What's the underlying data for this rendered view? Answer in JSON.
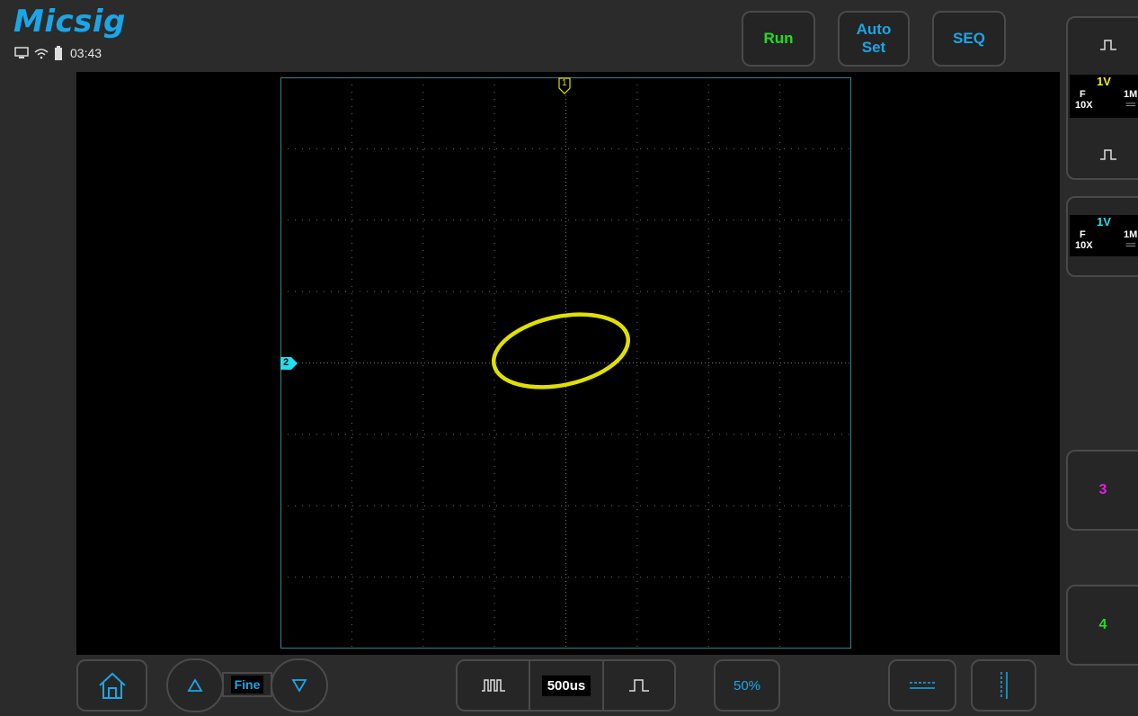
{
  "header": {
    "brand": "Micsig",
    "time": "03:43",
    "icons": [
      "monitor-icon",
      "wifi-icon",
      "battery-icon"
    ]
  },
  "top_buttons": {
    "run": "Run",
    "auto_line1": "Auto",
    "auto_line2": "Set",
    "seq": "SEQ"
  },
  "waveform": {
    "mode": "XY",
    "trace_color": "#e0e000",
    "ch1_marker": "1",
    "ch2_marker": "2",
    "grid_divisions": 8
  },
  "right_panel": {
    "ch1": {
      "volts": "1V",
      "coupling": "F",
      "impedance": "1M",
      "probe": "10X",
      "color": "#f0f000"
    },
    "ch2": {
      "volts": "1V",
      "coupling": "F",
      "impedance": "1M",
      "probe": "10X",
      "color": "#22e0f0"
    },
    "ch3_label": "3",
    "ch4_label": "4",
    "ch3_color": "#e020e0",
    "ch4_color": "#22dd22"
  },
  "bottom_bar": {
    "fine_label": "Fine",
    "timebase": "500us",
    "trigger_level": "50%"
  },
  "colors": {
    "accent": "#1aa6e8",
    "run": "#22dd22",
    "grid": "#3f7f88"
  }
}
